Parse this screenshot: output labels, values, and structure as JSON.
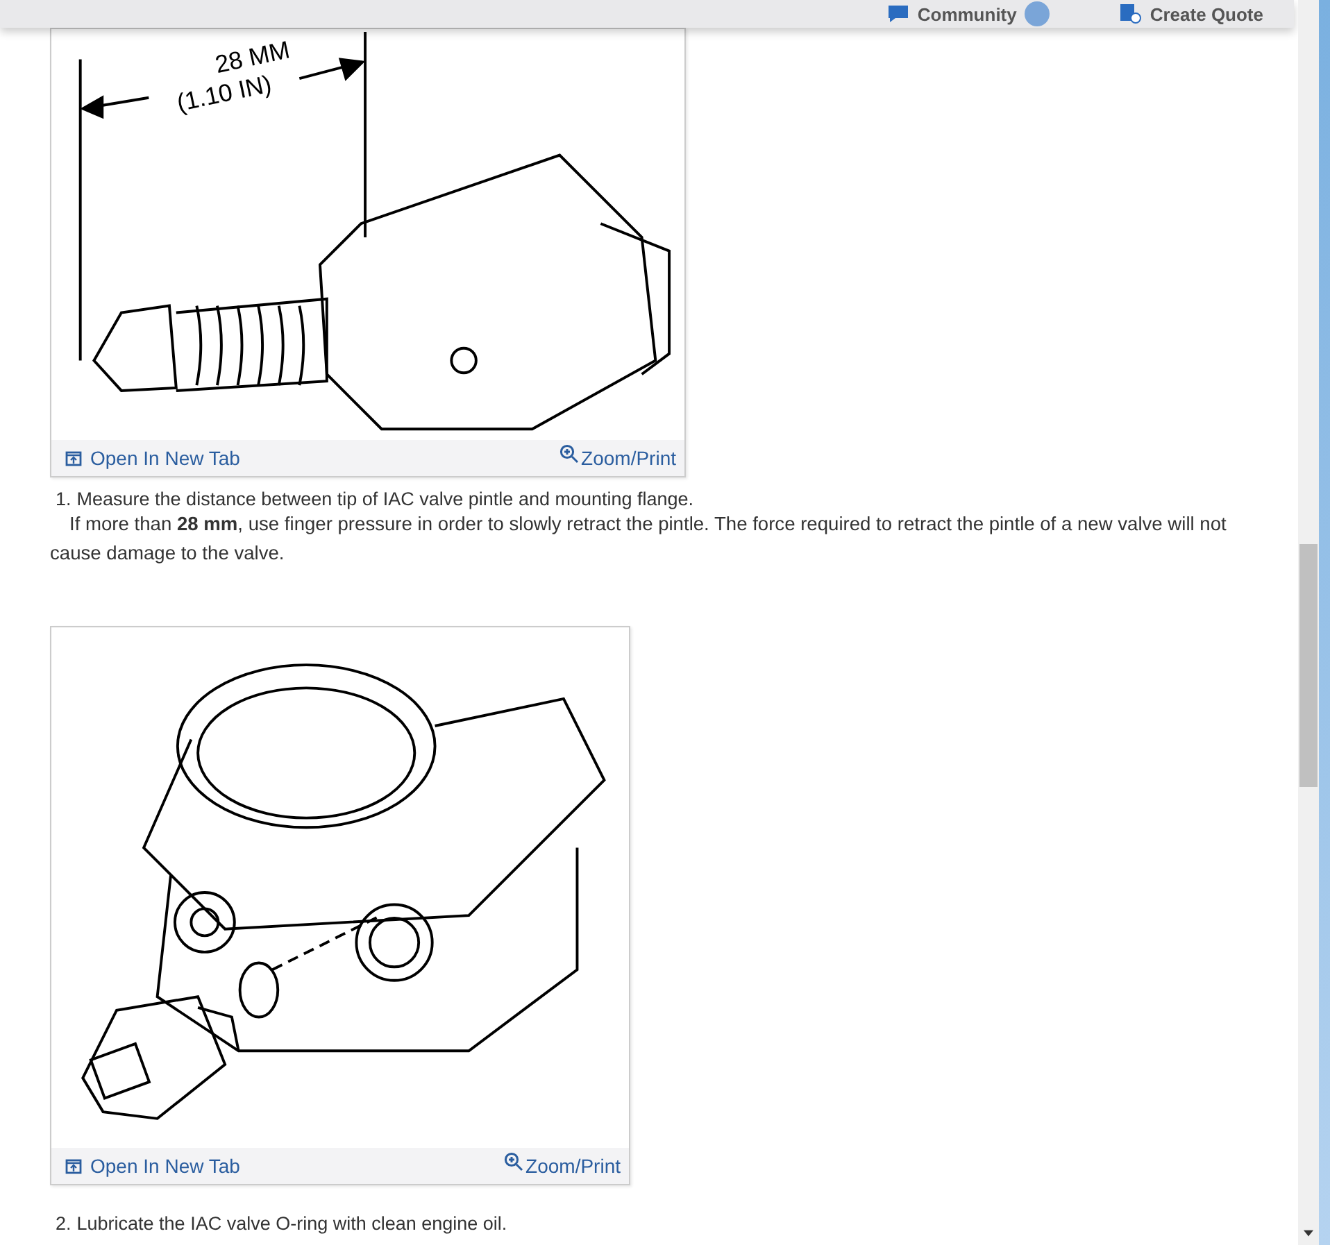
{
  "header": {
    "community": "Community",
    "quote": "Create Quote"
  },
  "figures": [
    {
      "kind": "valve",
      "dimension": [
        "28 MM",
        "(1.10 IN)"
      ],
      "open_link": "Open In New Tab",
      "zoom_link": "Zoom/Print"
    },
    {
      "kind": "throttle",
      "open_link": "Open In New Tab",
      "zoom_link": "Zoom/Print"
    }
  ],
  "steps": [
    {
      "number": "1.",
      "text": "Measure the distance between tip of IAC valve pintle and mounting flange.",
      "note": "If more than **28 mm**, use finger pressure in order to slowly retract the pintle. The force required to retract the pintle of a new valve will not cause damage to the valve."
    },
    {
      "number": "2.",
      "text": "Lubricate the IAC valve O-ring with clean engine oil."
    }
  ]
}
